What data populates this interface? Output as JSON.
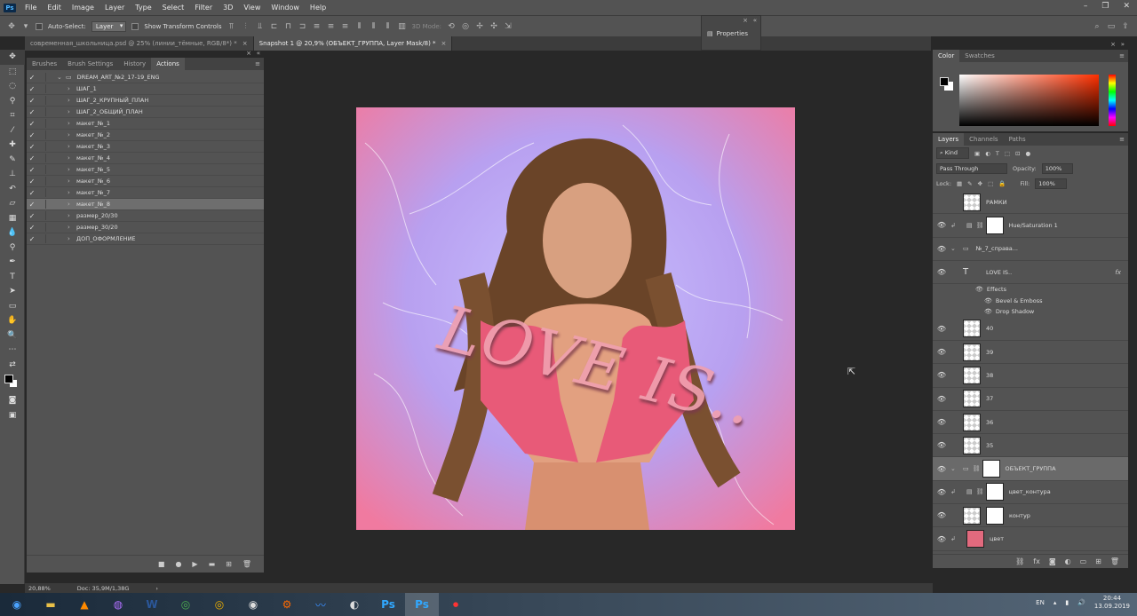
{
  "app": {
    "logo": "Ps"
  },
  "menu": [
    "File",
    "Edit",
    "Image",
    "Layer",
    "Type",
    "Select",
    "Filter",
    "3D",
    "View",
    "Window",
    "Help"
  ],
  "window_controls": [
    "–",
    "❐",
    "✕"
  ],
  "options_bar": {
    "auto_select_label": "Auto-Select:",
    "auto_select_value": "Layer",
    "transform_label": "Show Transform Controls",
    "mode_3d": "3D Mode:"
  },
  "doc_tabs": [
    {
      "label": "современная_школьница.psd @ 25% (линии_тёмные, RGB/8*) *",
      "active": false
    },
    {
      "label": "Snapshot 1 @ 20,9% (ОБЪЕКТ_ГРУППА, Layer Mask/8) *",
      "active": true
    }
  ],
  "properties_panel": {
    "label": "Properties"
  },
  "actions_panel": {
    "tabs": [
      "Brushes",
      "Brush Settings",
      "History",
      "Actions"
    ],
    "active_tab": "Actions",
    "set_name": "DREAM_ART_№2_17-19_ENG",
    "items": [
      "ШАГ_1",
      "ШАГ_2_КРУПНЫЙ_ПЛАН",
      "ШАГ_2_ОБЩИЙ_ПЛАН",
      "макет_№_1",
      "макет_№_2",
      "макет_№_3",
      "макет_№_4",
      "макет_№_5",
      "макет_№_6",
      "макет_№_7",
      "макет_№_8",
      "размер_20/30",
      "размер_30/20",
      "ДОП_ОФОРМЛЕНИЕ"
    ],
    "selected_index": 10
  },
  "canvas": {
    "text_overlay": "LOVE IS..",
    "colors": {
      "pink": "#f0a0c8",
      "violet": "#b8a8f0",
      "shirt": "#e85a78"
    }
  },
  "status": {
    "zoom": "20,88%",
    "doc": "Doc: 35,9M/1,38G"
  },
  "color_panel": {
    "tabs": [
      "Color",
      "Swatches"
    ],
    "active_tab": "Color",
    "hue_color": "#ff3000"
  },
  "layers_panel": {
    "tabs": [
      "Layers",
      "Channels",
      "Paths"
    ],
    "active_tab": "Layers",
    "kind_filter": "Kind",
    "blend_mode": "Pass Through",
    "opacity_label": "Opacity:",
    "opacity_value": "100%",
    "lock_label": "Lock:",
    "fill_label": "Fill:",
    "fill_value": "100%",
    "layers": [
      {
        "name": "РАМКИ",
        "type": "pixel",
        "visible": false
      },
      {
        "name": "Hue/Saturation 1",
        "type": "adjustment",
        "visible": true
      },
      {
        "name": "№_7_справа...",
        "type": "group",
        "visible": true
      },
      {
        "name": "LOVE IS..",
        "type": "text",
        "visible": true,
        "fx": "fx"
      },
      {
        "name": "Effects",
        "type": "effects"
      },
      {
        "name": "Bevel & Emboss",
        "type": "effect"
      },
      {
        "name": "Drop Shadow",
        "type": "effect"
      },
      {
        "name": "40",
        "type": "pixel",
        "visible": true
      },
      {
        "name": "39",
        "type": "pixel",
        "visible": true
      },
      {
        "name": "38",
        "type": "pixel",
        "visible": true
      },
      {
        "name": "37",
        "type": "pixel",
        "visible": true
      },
      {
        "name": "36",
        "type": "pixel",
        "visible": true
      },
      {
        "name": "35",
        "type": "pixel",
        "visible": true
      },
      {
        "name": "ОБЪЕКТ_ГРУППА",
        "type": "group-mask",
        "visible": true,
        "active": true
      },
      {
        "name": "цвет_контура",
        "type": "adjustment",
        "visible": true
      },
      {
        "name": "контур",
        "type": "pixel-mask",
        "visible": true
      },
      {
        "name": "цвет",
        "type": "image",
        "visible": true
      }
    ]
  },
  "taskbar": {
    "apps": [
      "start-icon",
      "explorer-icon",
      "vlc-icon",
      "media-icon",
      "word-icon",
      "chrome-icon",
      "chrome-canary-icon",
      "obs-icon",
      "tool-icon",
      "audio-icon",
      "steam-icon",
      "photoshop-icon",
      "photoshop-active-icon",
      "record-icon"
    ],
    "lang": "EN",
    "time": "20:44",
    "date": "13.09.2019"
  }
}
